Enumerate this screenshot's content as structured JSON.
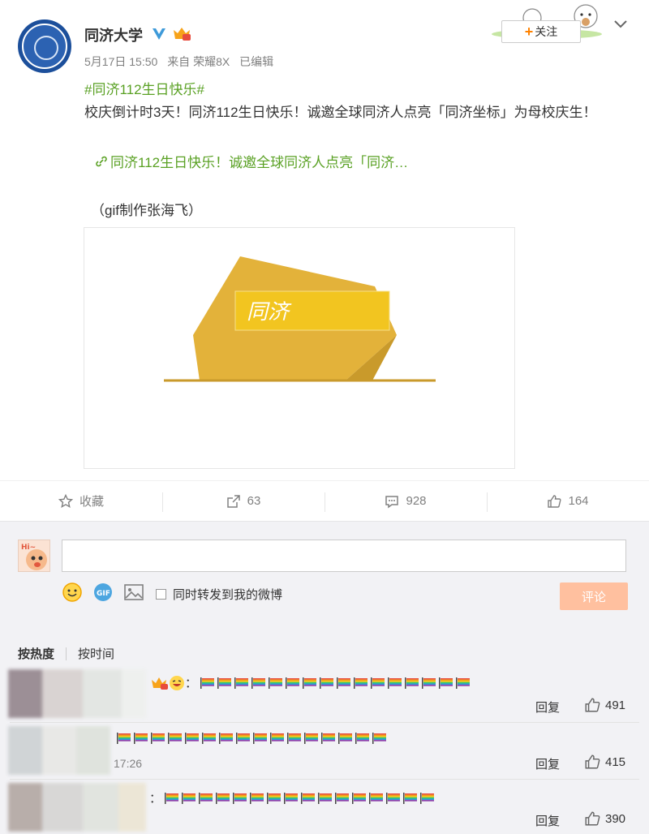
{
  "post": {
    "author": "同济大学",
    "date": "5月17日 15:50",
    "source": "来自 荣耀8X",
    "edited": "已编辑",
    "hashtag": "#同济112生日快乐#",
    "content": "校庆倒计时3天！同济112生日快乐！诚邀全球同济人点亮「同济坐标」为母校庆生！",
    "link_text": "同济112生日快乐！诚邀全球同济人点亮「同济…",
    "credit": "（gif制作张海飞）",
    "media_text": "同济",
    "follow_label": "关注"
  },
  "colors": {
    "accent_green": "#5aa124",
    "follow_plus": "#ff8200",
    "gold": "#e3b23a",
    "gold_dark": "#c99a2b",
    "banner": "#f2c520",
    "submit_bg": "#ffc09f"
  },
  "actions": {
    "favorite": "收藏",
    "repost": "63",
    "comments": "928",
    "likes": "164"
  },
  "comment_box": {
    "placeholder": "",
    "sync_label": "同时转发到我的微博",
    "submit": "评论",
    "icons": [
      "smile-icon",
      "gif-icon",
      "image-icon"
    ]
  },
  "sort": {
    "hot": "按热度",
    "time": "按时间"
  },
  "comments": [
    {
      "prefix": "：",
      "flags": 16,
      "time": "",
      "reply": "回复",
      "likes": "491"
    },
    {
      "prefix": "",
      "flags": 16,
      "time": "17:26",
      "reply": "回复",
      "likes": "415"
    },
    {
      "prefix": "：",
      "flags": 16,
      "time": "",
      "reply": "回复",
      "likes": "390"
    }
  ]
}
